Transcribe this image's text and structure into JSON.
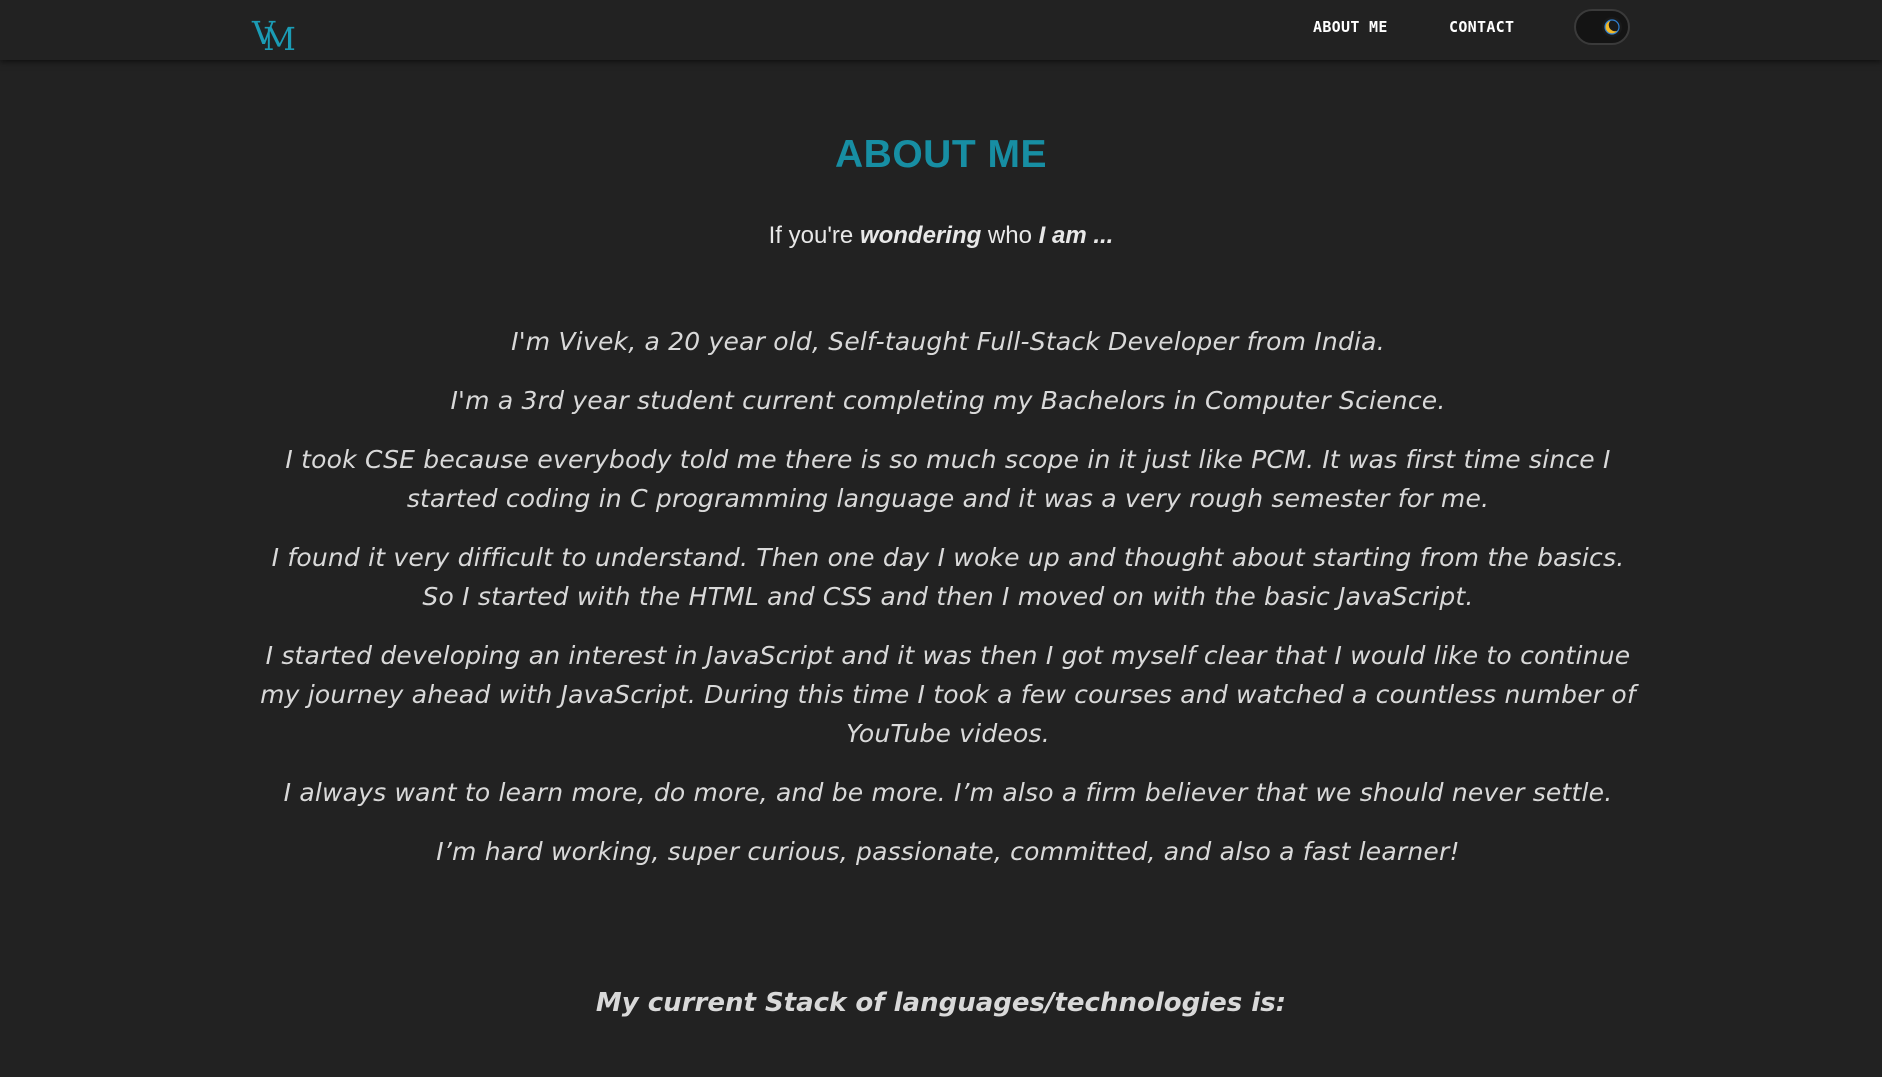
{
  "nav": {
    "logo_text_a": "V",
    "logo_text_b": "M",
    "links": [
      {
        "label": "ABOUT ME"
      },
      {
        "label": "CONTACT"
      }
    ],
    "theme_toggle_icon": "moon-icon"
  },
  "colors": {
    "background": "#222222",
    "accent": "#178ea3",
    "text": "#d9d9d9"
  },
  "about": {
    "title": "ABOUT ME",
    "subtitle_parts": [
      "If you're ",
      "wondering",
      " who ",
      "I am ..."
    ],
    "paragraphs": [
      "I'm Vivek, a 20 year old, Self-taught Full-Stack Developer from India.",
      "I'm a 3rd year student current completing my Bachelors in Computer Science.",
      "I took CSE because everybody told me there is so much scope in it just like PCM. It was first time since I started coding in C programming language and it was a very rough semester for me.",
      "I found it very difficult to understand. Then one day I woke up and thought about starting from the basics. So I started with the HTML and CSS and then I moved on with the basic JavaScript.",
      "I started developing an interest in JavaScript and it was then I got myself clear that I would like to continue my journey ahead with JavaScript. During this time I took a few courses and watched a countless number of YouTube videos.",
      "I always want to learn more, do more, and be more. I’m also a firm believer that we should never settle.",
      "I’m hard working, super curious, passionate, committed, and also a fast learner!"
    ],
    "stack_heading": "My current Stack of languages/technologies is:"
  }
}
